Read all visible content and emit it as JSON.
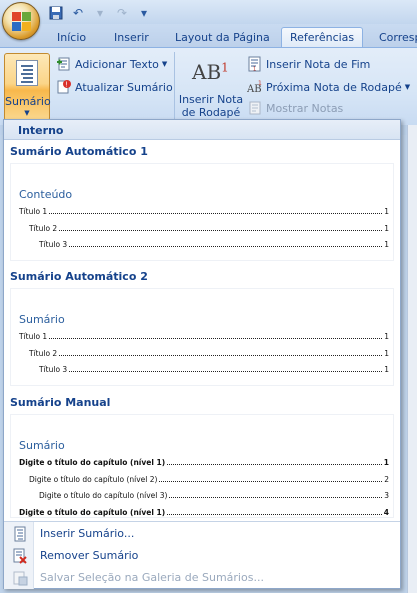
{
  "tabs": [
    "Início",
    "Inserir",
    "Layout da Página",
    "Referências",
    "Corresp"
  ],
  "active_tab": "Referências",
  "ribbon": {
    "toc_button": "Sumário",
    "add_text": "Adicionar Texto",
    "update_toc": "Atualizar Sumário",
    "insert_footnote_line1": "Inserir Nota",
    "insert_footnote_line2": "de Rodapé",
    "insert_endnote": "Inserir Nota de Fim",
    "next_footnote": "Próxima Nota de Rodapé",
    "show_notes": "Mostrar Notas"
  },
  "dropdown": {
    "header": "Interno",
    "galleries": [
      {
        "title": "Sumário Automático 1",
        "heading": "Conteúdo",
        "entries": [
          {
            "text": "Título 1",
            "page": "1",
            "level": 1
          },
          {
            "text": "Título 2",
            "page": "1",
            "level": 2
          },
          {
            "text": "Título 3",
            "page": "1",
            "level": 3
          }
        ]
      },
      {
        "title": "Sumário Automático 2",
        "heading": "Sumário",
        "entries": [
          {
            "text": "Título 1",
            "page": "1",
            "level": 1
          },
          {
            "text": "Título 2",
            "page": "1",
            "level": 2
          },
          {
            "text": "Título 3",
            "page": "1",
            "level": 3
          }
        ]
      },
      {
        "title": "Sumário Manual",
        "heading": "Sumário",
        "entries": [
          {
            "text": "Digite o título do capítulo (nível 1)",
            "page": "1",
            "level": 1
          },
          {
            "text": "Digite o título do capítulo (nível 2)",
            "page": "2",
            "level": 2
          },
          {
            "text": "Digite o título do capítulo (nível 3)",
            "page": "3",
            "level": 3
          },
          {
            "text": "Digite o título do capítulo (nível 1)",
            "page": "4",
            "level": 1
          }
        ]
      }
    ],
    "menu": {
      "insert_toc": "Inserir Sumário...",
      "remove_toc": "Remover Sumário",
      "save_selection": "Salvar Seleção na Galeria de Sumários..."
    }
  },
  "colors": {
    "accent": "#15428b",
    "toc_heading": "#2c5f9e",
    "selected_button": "#f8b84c"
  }
}
